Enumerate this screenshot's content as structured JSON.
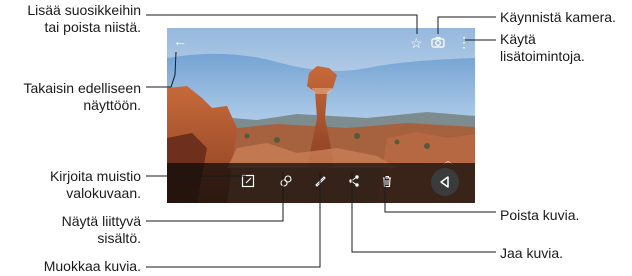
{
  "callouts": {
    "favorite": "Lisää suosikkeihin\ntai poista niistä.",
    "back": "Takaisin edelliseen\nnäyttöön.",
    "memo": "Kirjoita muistio\nvalokuvaan.",
    "related": "Näytä liittyvä\nsisältö.",
    "edit": "Muokkaa kuvia.",
    "camera": "Käynnistä kamera.",
    "more": "Käytä\nlisätoimintoja.",
    "delete": "Poista kuvia.",
    "share": "Jaa kuvia."
  },
  "icons": {
    "back": "back-arrow-icon",
    "favorite": "star-icon",
    "camera": "camera-icon",
    "more": "more-options-icon",
    "memo": "memo-icon",
    "related": "related-content-icon",
    "edit": "pencil-icon",
    "share": "share-icon",
    "delete": "trash-icon",
    "home": "back-triangle-icon"
  },
  "colors": {
    "line": "#1a1a1a",
    "toolbar": "#0a0a0a"
  }
}
